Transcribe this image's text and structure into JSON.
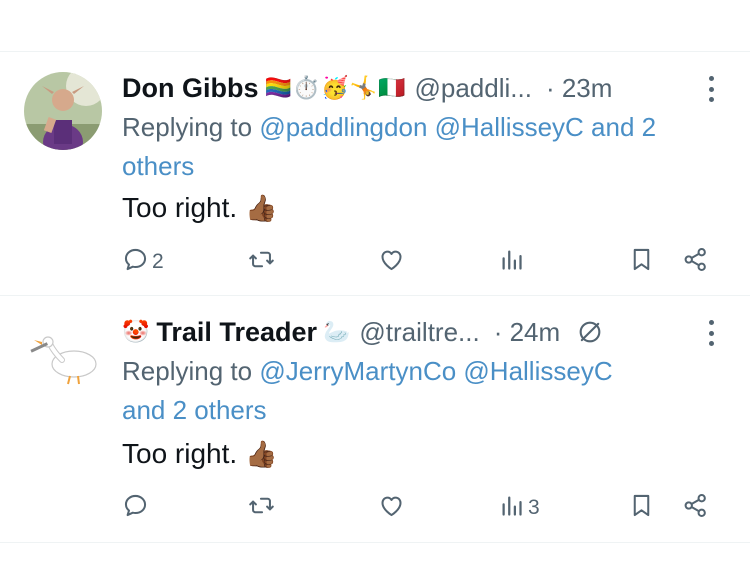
{
  "tweets": [
    {
      "display_name": "Don Gibbs",
      "name_emojis": "🏳️‍🌈⏱️🥳🤸🇮🇹",
      "handle": "@paddli...",
      "time": "· 23m",
      "reply_prefix": "Replying to",
      "reply_line1_mentions": "@paddlingdon @HallisseyC and 2",
      "reply_line2": "others",
      "text": "Too right.",
      "text_emoji": "👍🏾",
      "stats": {
        "replies": "2",
        "views": ""
      }
    },
    {
      "prefix_emoji": "🤡",
      "display_name": "Trail Treader",
      "name_emojis": "🦢",
      "handle": "@trailtre...",
      "time": "· 24m",
      "reply_prefix": "Replying to",
      "reply_line1_mentions": "@JerryMartynCo @HallisseyC",
      "reply_line2": "and 2 others",
      "text": "Too right.",
      "text_emoji": "👍🏾",
      "stats": {
        "replies": "",
        "views": "3"
      }
    }
  ],
  "colors": {
    "text": "#0f1419",
    "secondary": "#536471",
    "link": "#4a8fc6",
    "divider": "#eff3f4"
  },
  "icons": [
    "reply-icon",
    "repost-icon",
    "like-icon",
    "views-icon",
    "bookmark-icon",
    "share-icon",
    "more-icon",
    "mute-icon"
  ]
}
